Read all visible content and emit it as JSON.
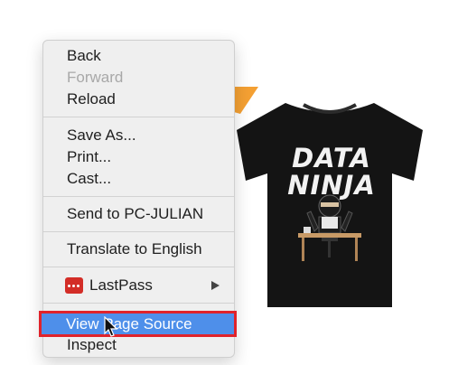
{
  "menu": {
    "items": {
      "back": "Back",
      "forward": "Forward",
      "reload": "Reload",
      "save_as": "Save As...",
      "print": "Print...",
      "cast": "Cast...",
      "send_to": "Send to PC-JULIAN",
      "translate": "Translate to English",
      "lastpass": "LastPass",
      "view_source": "View Page Source",
      "inspect": "Inspect"
    }
  },
  "product": {
    "shirt_text_line1": "DATA",
    "shirt_text_line2": "NINJA",
    "shirt_color": "#141414",
    "accent_tag_color": "#f4a033"
  },
  "colors": {
    "highlight": "#4e8fea",
    "highlight_border": "#e0232b",
    "lastpass_red": "#d32d27"
  },
  "icons": {
    "lastpass": "lastpass-icon",
    "submenu": "chevron-right-icon",
    "cursor": "mouse-pointer-icon"
  }
}
